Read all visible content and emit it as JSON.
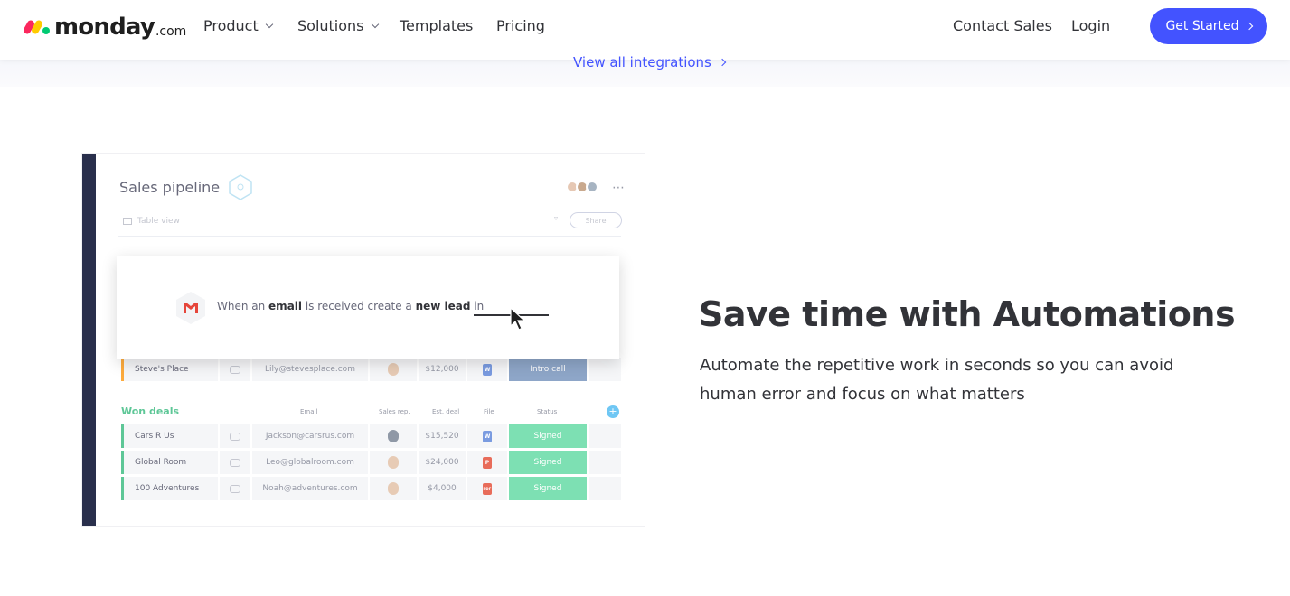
{
  "nav": {
    "logo_word": "monday",
    "logo_suffix": ".com",
    "links": [
      {
        "label": "Product"
      },
      {
        "label": "Solutions"
      },
      {
        "label": "Templates"
      },
      {
        "label": "Pricing"
      }
    ],
    "contact_sales": "Contact Sales",
    "login": "Login",
    "get_started": "Get Started",
    "accent_color": "#4353ff"
  },
  "integrations": {
    "view_all": "View all integrations"
  },
  "board": {
    "title": "Sales pipeline",
    "view_label": "Table view",
    "share_label": "Share",
    "more": "⋯",
    "intro_row": {
      "name": "Steve's Place",
      "email": "Lily@stevesplace.com",
      "deal": "$12,000",
      "file": "W",
      "status": "Intro call"
    },
    "won_group": {
      "title": "Won deals",
      "columns": {
        "email": "Email",
        "sales_rep": "Sales rep.",
        "deal": "Est. deal",
        "file": "File",
        "status": "Status"
      },
      "rows": [
        {
          "name": "Cars R Us",
          "email": "Jackson@carsrus.com",
          "deal": "$15,520",
          "file": "W",
          "status": "Signed"
        },
        {
          "name": "Global Room",
          "email": "Leo@globalroom.com",
          "deal": "$24,000",
          "file": "P",
          "status": "Signed"
        },
        {
          "name": "100 Adventures",
          "email": "Noah@adventures.com",
          "deal": "$4,000",
          "file": "PDF",
          "status": "Signed"
        }
      ]
    },
    "automation": {
      "part1": "When an ",
      "email": "email",
      "part2": " is received create a ",
      "new_lead": "new lead",
      "part3": " in"
    }
  },
  "feature": {
    "headline": "Save time with Automations",
    "description": "Automate the repetitive work in seconds so you can avoid human error and focus on what matters"
  }
}
